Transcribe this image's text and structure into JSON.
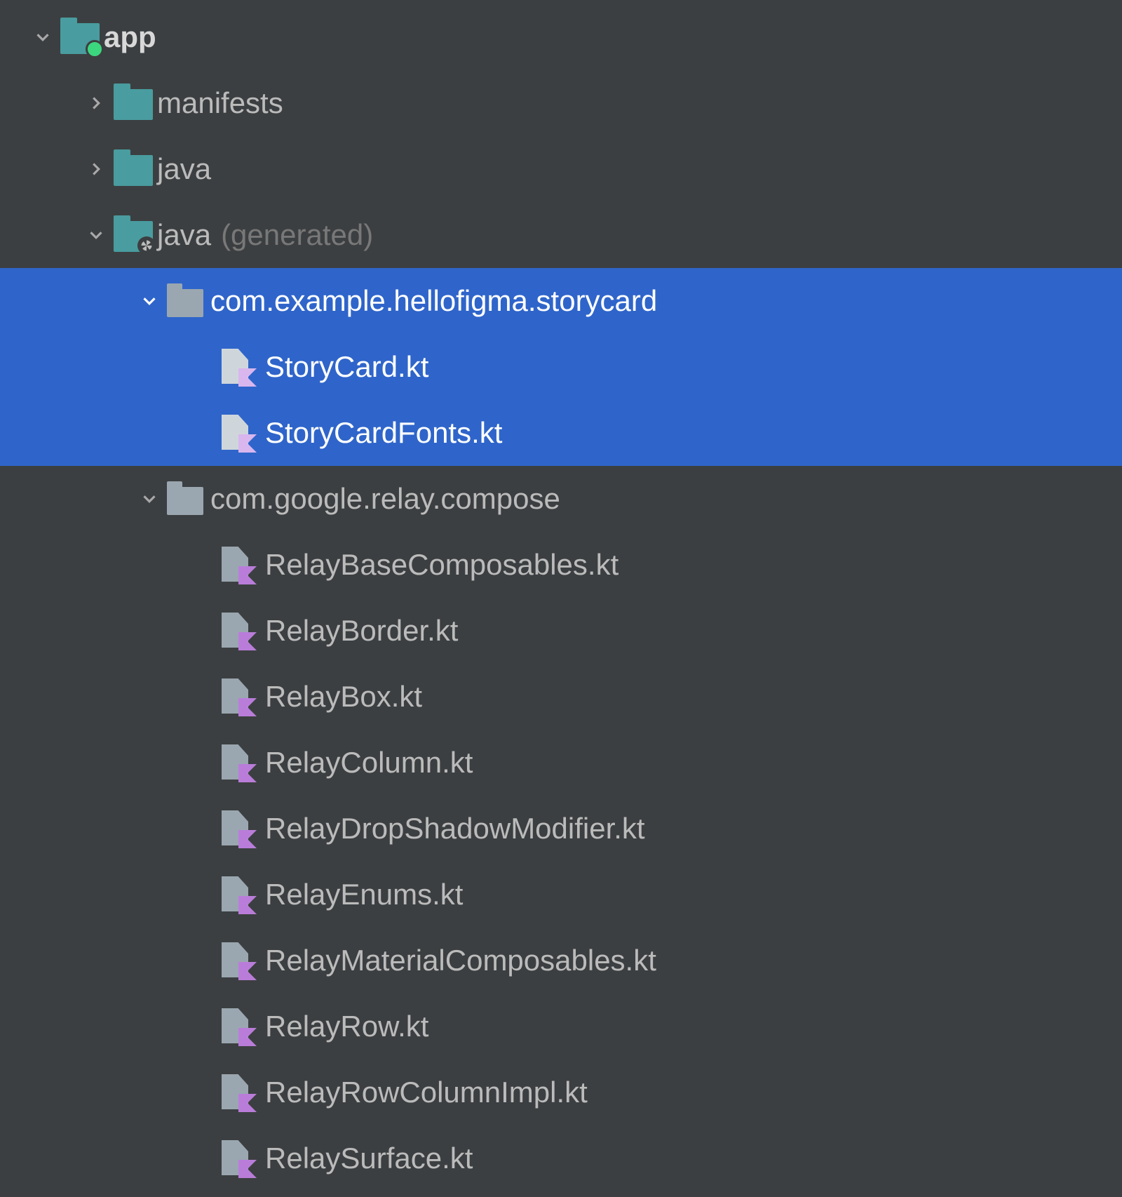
{
  "tree": {
    "root": {
      "label": "app",
      "expanded": true,
      "children": {
        "manifests": {
          "label": "manifests",
          "expanded": false
        },
        "java_plain": {
          "label": "java",
          "expanded": false
        },
        "java_gen": {
          "label": "java",
          "suffix": "(generated)",
          "expanded": true,
          "packages": {
            "storycard": {
              "label": "com.example.hellofigma.storycard",
              "expanded": true,
              "selected": true,
              "files": [
                "StoryCard.kt",
                "StoryCardFonts.kt"
              ]
            },
            "relay": {
              "label": "com.google.relay.compose",
              "expanded": true,
              "selected": false,
              "files": [
                "RelayBaseComposables.kt",
                "RelayBorder.kt",
                "RelayBox.kt",
                "RelayColumn.kt",
                "RelayDropShadowModifier.kt",
                "RelayEnums.kt",
                "RelayMaterialComposables.kt",
                "RelayRow.kt",
                "RelayRowColumnImpl.kt",
                "RelaySurface.kt"
              ]
            }
          }
        }
      }
    }
  },
  "colors": {
    "background": "#3c3f41",
    "selection": "#2f65ca",
    "text": "#bbbbbb",
    "muted": "#787878",
    "folderTeal": "#499c9f",
    "folderGray": "#9aa7b0",
    "kotlinAccent": "#b97dd9",
    "moduleDot": "#3cd67f"
  }
}
